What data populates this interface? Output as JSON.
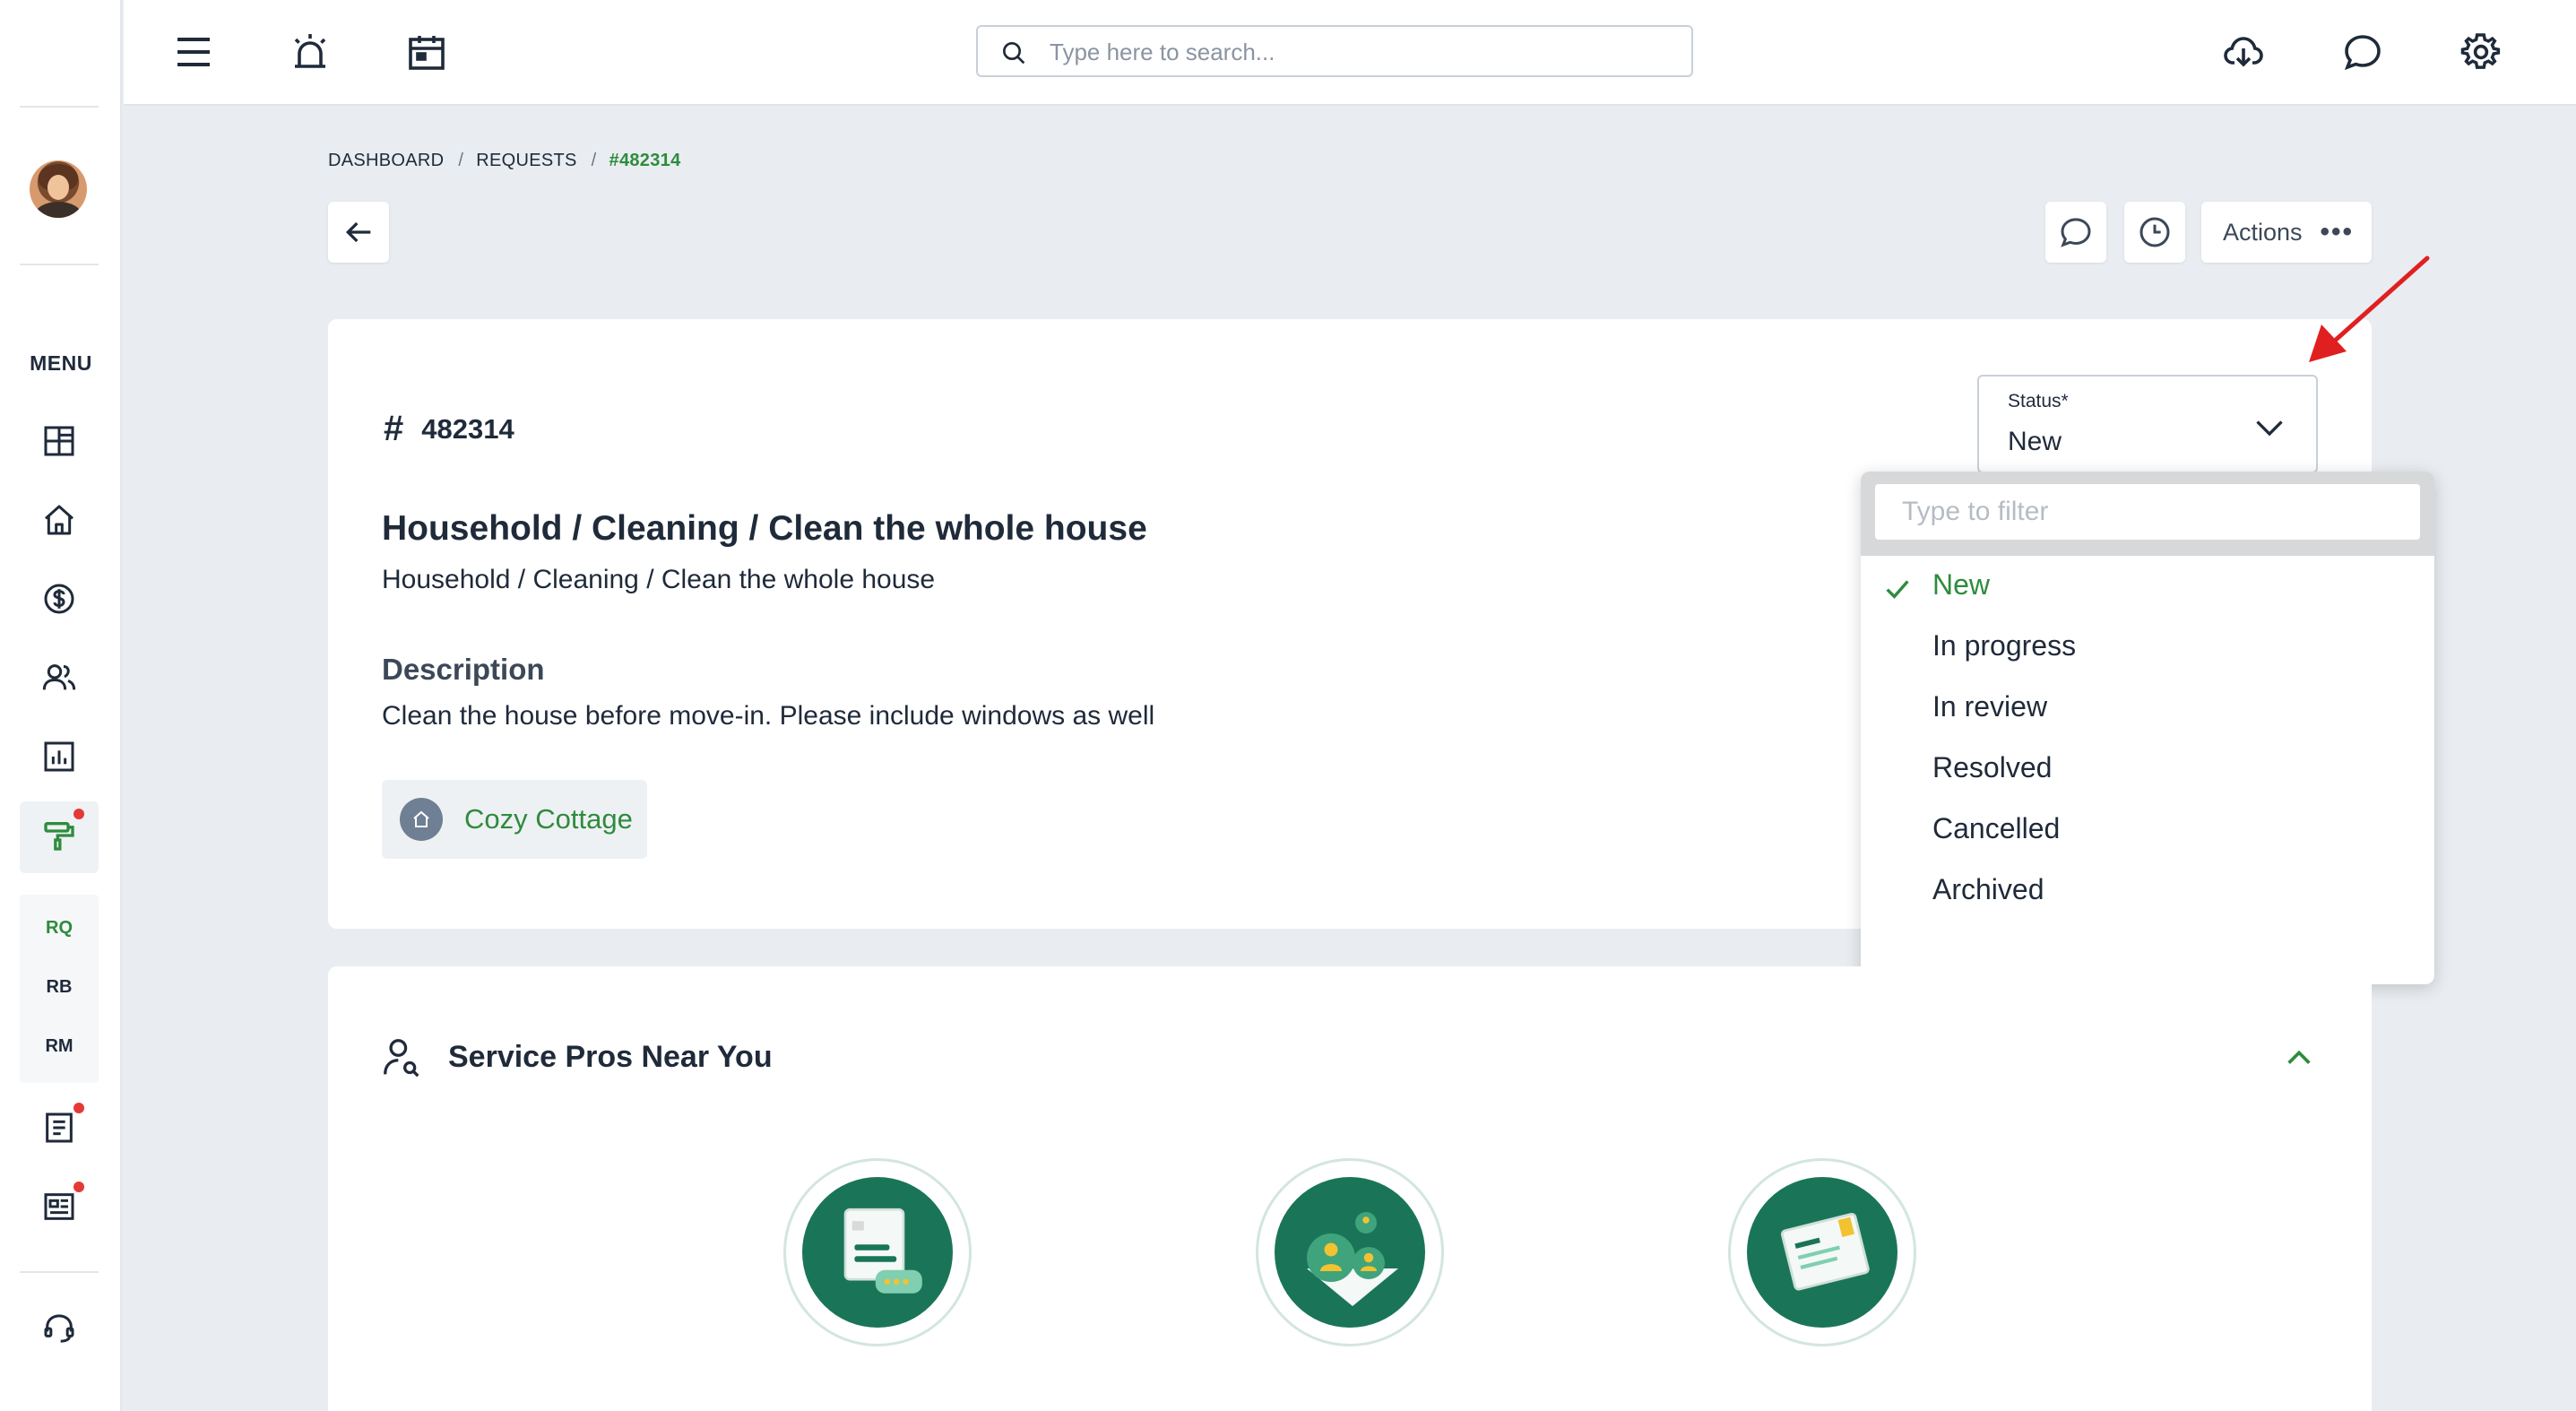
{
  "header": {
    "search_placeholder": "Type here to search..."
  },
  "sidebar": {
    "menu_label": "MENU",
    "sub_items": [
      "RQ",
      "RB",
      "RM"
    ]
  },
  "breadcrumb": {
    "items": [
      "DASHBOARD",
      "REQUESTS",
      "#482314"
    ]
  },
  "toolbar": {
    "actions_label": "Actions",
    "actions_dots": "•••"
  },
  "request": {
    "id_hash": "#",
    "id": "482314",
    "title": "Household / Cleaning / Clean the whole house",
    "subtitle": "Household / Cleaning / Clean the whole house",
    "description_heading": "Description",
    "description": "Clean the house before move-in. Please include windows as well",
    "property_chip": "Cozy Cottage"
  },
  "status": {
    "caption": "Status*",
    "value": "New",
    "filter_placeholder": "Type to filter",
    "options": [
      "New",
      "In progress",
      "In review",
      "Resolved",
      "Cancelled",
      "Archived"
    ],
    "selected": "New"
  },
  "service_pros": {
    "title": "Service Pros Near You"
  },
  "colors": {
    "accent_green": "#2e8b3d",
    "illustration_green": "#1a7558",
    "alert_red": "#e53935"
  }
}
